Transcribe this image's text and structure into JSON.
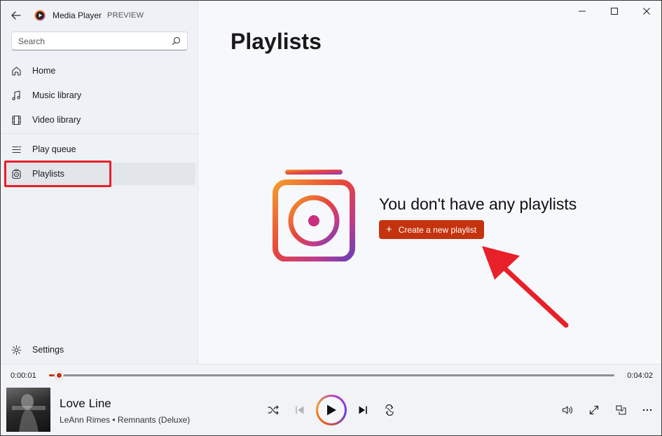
{
  "app": {
    "title": "Media Player",
    "badge": "PREVIEW"
  },
  "search": {
    "placeholder": "Search"
  },
  "sidebar": {
    "items": [
      {
        "label": "Home",
        "icon": "home-icon"
      },
      {
        "label": "Music library",
        "icon": "music-note-icon"
      },
      {
        "label": "Video library",
        "icon": "film-icon"
      },
      {
        "label": "Play queue",
        "icon": "queue-icon"
      },
      {
        "label": "Playlists",
        "icon": "playlist-icon"
      }
    ],
    "settings_label": "Settings"
  },
  "main": {
    "page_title": "Playlists",
    "empty_heading": "You don't have any playlists",
    "create_button": "Create a new playlist"
  },
  "player": {
    "current_time": "0:00:01",
    "total_time": "0:04:02",
    "progress": 0.004,
    "song_title": "Love Line",
    "song_meta": "LeAnn Rimes • Remnants (Deluxe)"
  },
  "colors": {
    "accent": "#c4330d",
    "annotation": "#e8202a"
  }
}
